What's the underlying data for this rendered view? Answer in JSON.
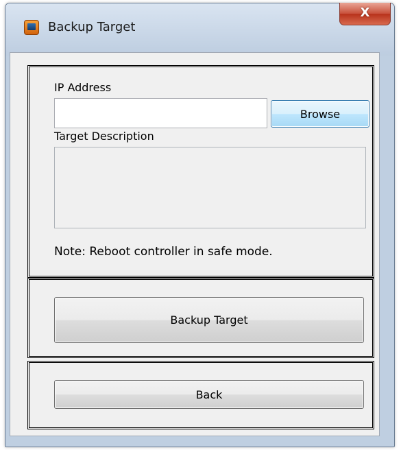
{
  "window": {
    "title": "Backup Target",
    "close_label": "X"
  },
  "form": {
    "ip_label": "IP Address",
    "ip_value": "",
    "browse_label": "Browse",
    "description_label": "Target Description",
    "description_value": "",
    "note": "Note: Reboot controller in safe mode."
  },
  "actions": {
    "backup_label": "Backup Target",
    "back_label": "Back"
  },
  "icons": {
    "app": "app-icon",
    "close": "close-icon"
  },
  "colors": {
    "titlebar": "#bfcfe1",
    "client_bg": "#f0f0f0",
    "close_button": "#c8503a",
    "browse_button": "#bee6fd"
  }
}
